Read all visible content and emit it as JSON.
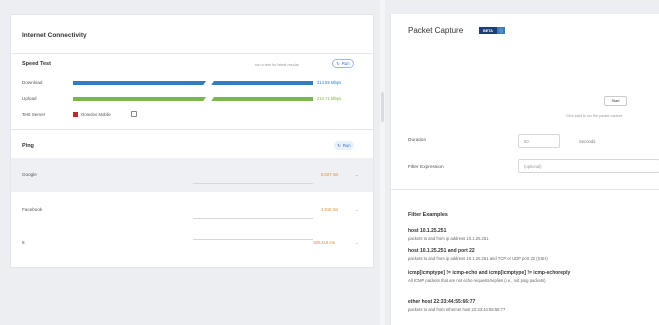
{
  "internet": {
    "title": "Internet Connectivity",
    "speed_test": {
      "label": "Speed Test",
      "run_hint": "run a test for latest results",
      "run_button": "Run",
      "rows": [
        {
          "label": "Download",
          "value": "214.85 Mbps",
          "color": "#2e7dc6"
        },
        {
          "label": "Upload",
          "value": "210.71 Mbps",
          "color": "#7ab648"
        }
      ],
      "test_server_label": "Test Server",
      "test_server_name": "Ooredoo Mobile"
    },
    "ping": {
      "label": "Ping",
      "run_button": "Run",
      "rows": [
        {
          "label": "Google",
          "value": "5.027 ms"
        },
        {
          "label": "Facebook",
          "value": "4.816 ms"
        },
        {
          "label": "8",
          "value": "180.218 ms"
        }
      ]
    }
  },
  "packet_capture": {
    "title": "Packet Capture",
    "badge": "BETA",
    "start_button": "Start",
    "hint": "Click start to run the packet capture",
    "duration_label": "Duration",
    "duration_value": "60",
    "duration_unit": "Seconds",
    "filter_label": "Filter Expression",
    "filter_placeholder": "(optional)",
    "filter_examples_title": "Filter Examples",
    "examples": [
      {
        "cmd": "host 10.1.25.251",
        "desc": "packets to and from ip address 10.1.25.251"
      },
      {
        "cmd": "host 10.1.25.251 and port 22",
        "desc": "packets to and from ip address 10.1.25.251 and TCP or UDP port 22 (SSH)"
      },
      {
        "cmd": "icmp[icmptype] != icmp-echo and icmp[icmptype] != icmp-echoreply",
        "desc": "All ICMP packets that are not echo requests/replies (i.e., not ping packets)"
      },
      {
        "cmd": "ether host 22:33:44:55:66:77",
        "desc": "packets to and from ethernet host 22:33:44:55:66:77"
      }
    ]
  }
}
